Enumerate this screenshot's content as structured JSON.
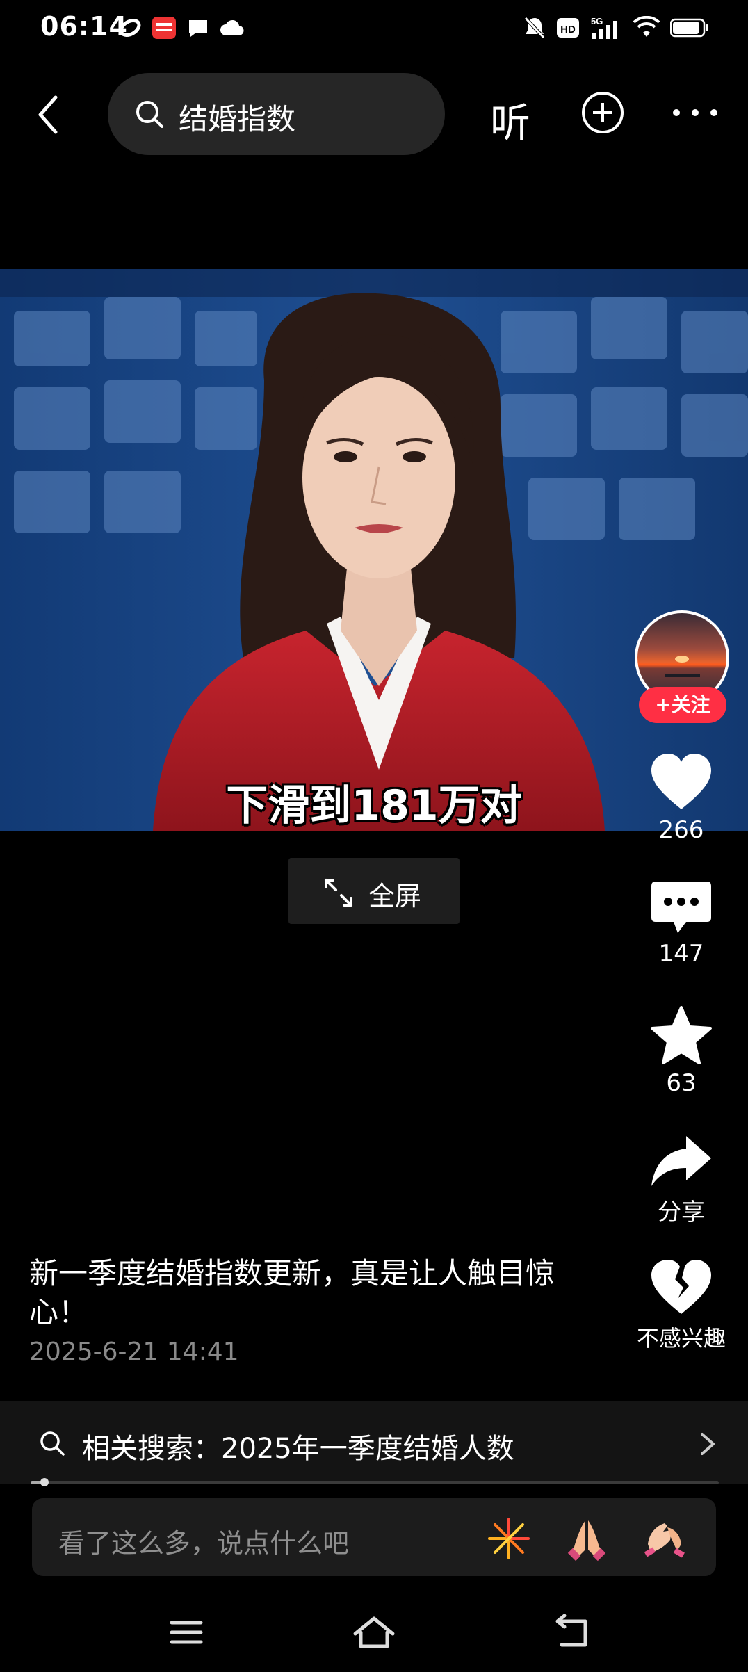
{
  "status_bar": {
    "time": "06:14",
    "battery_level": 0.9
  },
  "search": {
    "query": "结婚指数"
  },
  "header": {
    "listen_label": "听"
  },
  "video": {
    "subtitle": "下滑到181万对"
  },
  "fullscreen": {
    "label": "全屏"
  },
  "author": {
    "follow_label": "+关注"
  },
  "actions": {
    "likes": "266",
    "comments": "147",
    "favorites": "63",
    "share_label": "分享",
    "not_interested_label": "不感兴趣"
  },
  "post": {
    "caption": "新一季度结婚指数更新，真是让人触目惊心！",
    "timestamp": "2025-6-21 14:41"
  },
  "related_search": {
    "text": "相关搜索：2025年一季度结婚人数"
  },
  "playback": {
    "progress": 0.02
  },
  "comment_bar": {
    "placeholder": "看了这么多，说点什么吧"
  },
  "icons": {
    "status_left": [
      "sync-icon",
      "app-news-icon",
      "message-icon",
      "cloud-icon"
    ],
    "status_right": [
      "mute-icon",
      "hd-icon",
      "5g-signal-icon",
      "wifi-icon",
      "battery-icon"
    ],
    "emoji": [
      "fireworks-emoji",
      "pray-emoji",
      "high-five-emoji"
    ],
    "nav": [
      "menu-icon",
      "home-icon",
      "back-icon"
    ]
  },
  "colors": {
    "accent": "#ff2f44",
    "background": "#000000"
  }
}
